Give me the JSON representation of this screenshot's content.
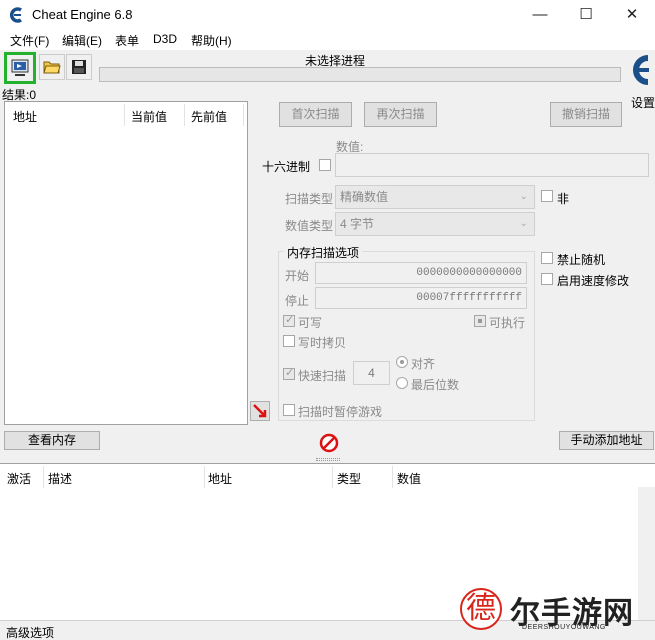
{
  "window": {
    "title": "Cheat Engine 6.8",
    "minimize": "—",
    "maximize": "☐",
    "close": "✕"
  },
  "menu": [
    {
      "label": "文件(F)"
    },
    {
      "label": "编辑(E)"
    },
    {
      "label": "表单"
    },
    {
      "label": "D3D"
    },
    {
      "label": "帮助(H)"
    }
  ],
  "toolbar": {
    "process_label": "未选择进程",
    "settings_label": "设置"
  },
  "results": {
    "label": "结果:0"
  },
  "result_list": {
    "columns": [
      "地址",
      "当前值",
      "先前值"
    ]
  },
  "scan": {
    "first_scan": "首次扫描",
    "next_scan": "再次扫描",
    "undo_scan": "撤销扫描",
    "value_label": "数值:",
    "hex_label": "十六进制",
    "scan_type_label": "扫描类型",
    "scan_type_value": "精确数值",
    "value_type_label": "数值类型",
    "value_type_value": "4 字节",
    "not_label": "非",
    "mem_options_title": "内存扫描选项",
    "start_label": "开始",
    "start_value": "0000000000000000",
    "stop_label": "停止",
    "stop_value": "00007fffffffffff",
    "writable_label": "可写",
    "executable_label": "可执行",
    "copy_on_write_label": "写时拷贝",
    "fast_scan_label": "快速扫描",
    "fast_scan_value": "4",
    "align_label": "对齐",
    "last_digits_label": "最后位数",
    "pause_label": "扫描时暂停游戏",
    "disable_random_label": "禁止随机",
    "speedhack_label": "启用速度修改"
  },
  "buttons": {
    "view_memory": "查看内存",
    "add_address": "手动添加地址"
  },
  "address_list": {
    "columns": [
      "激活",
      "描述",
      "地址",
      "类型",
      "数值"
    ]
  },
  "bottom": {
    "advanced_label": "高级选项"
  },
  "watermark": {
    "char": "德",
    "brand": "尔手游网",
    "url": "DEERSHOUYOUWANG"
  },
  "colors": {
    "highlight": "#22b22b",
    "watermark_red": "#d9261c"
  }
}
